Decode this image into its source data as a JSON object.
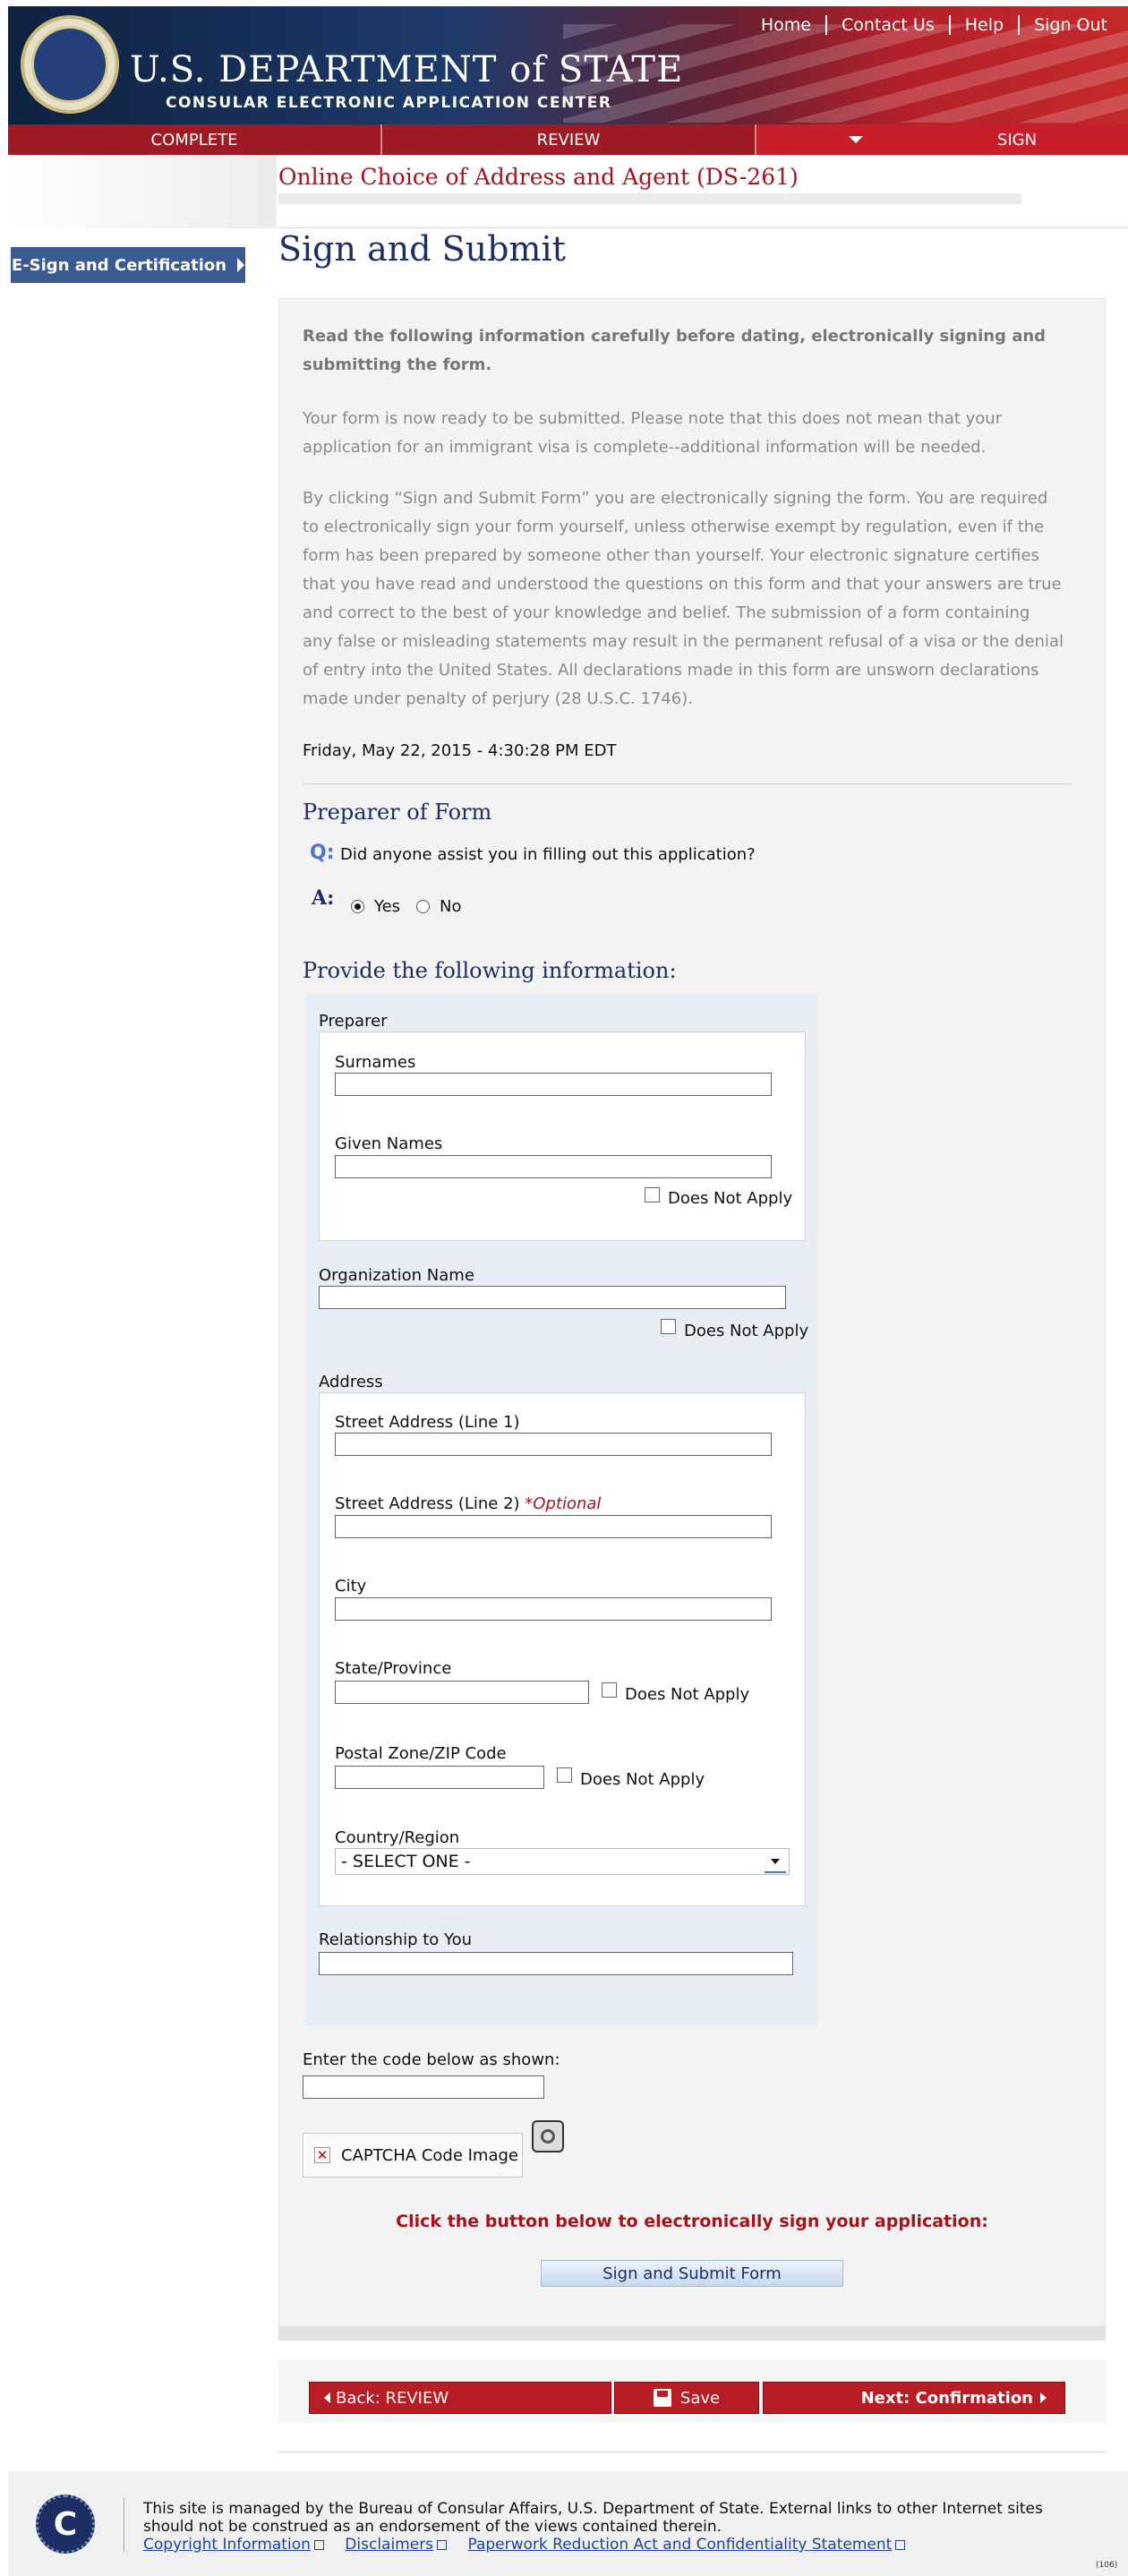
{
  "header": {
    "top_links": [
      "Home",
      "Contact Us",
      "Help",
      "Sign Out"
    ],
    "dept_title": "U.S. DEPARTMENT of STATE",
    "dept_subtitle": "CONSULAR ELECTRONIC APPLICATION CENTER",
    "tabs": [
      "COMPLETE",
      "REVIEW",
      "SIGN"
    ]
  },
  "form_title": "Online Choice of Address and Agent (DS-261)",
  "left_nav": {
    "item": "E-Sign and Certification"
  },
  "page_heading": "Sign and Submit",
  "intro": {
    "bold": "Read the following information carefully before dating, electronically signing and submitting the form.",
    "para1": "Your form is now ready to be submitted. Please note that this does not mean that your application for an immigrant visa is complete--additional information will be needed.",
    "para2": "By clicking “Sign and Submit Form” you are electronically signing the form. You are required to electronically sign your form yourself, unless otherwise exempt by regulation, even if the form has been prepared by someone other than yourself. Your electronic signature certifies that you have read and understood the questions on this form and that your answers are true and correct to the best of your knowledge and belief. The submission of a form containing any false or misleading statements may result in the permanent refusal of a visa or the denial of entry into the United States. All declarations made in this form are unsworn declarations made under penalty of perjury (28 U.S.C. 1746).",
    "timestamp": "Friday, May 22, 2015 - 4:30:28 PM EDT"
  },
  "preparer": {
    "heading": "Preparer of Form",
    "q_label": "Q:",
    "question": "Did anyone assist you in filling out this application?",
    "a_label": "A:",
    "yes": "Yes",
    "no": "No",
    "selected": "Yes"
  },
  "provide_heading": "Provide the following information:",
  "info": {
    "preparer_label": "Preparer",
    "surnames": "Surnames",
    "given_names": "Given Names",
    "does_not_apply": "Does Not Apply",
    "org_name": "Organization Name",
    "address_label": "Address",
    "street1": "Street Address (Line 1)",
    "street2": "Street Address (Line 2)",
    "optional": "*Optional",
    "city": "City",
    "state": "State/Province",
    "postal": "Postal Zone/ZIP Code",
    "country": "Country/Region",
    "country_value": "- SELECT ONE -",
    "relationship": "Relationship to You"
  },
  "captcha": {
    "label": "Enter the code below as shown:",
    "image_alt": "CAPTCHA Code Image"
  },
  "sign": {
    "prompt": "Click the button below to electronically sign your application:",
    "button": "Sign and Submit Form"
  },
  "bottom_nav": {
    "back": "Back: REVIEW",
    "save": "Save",
    "next": "Next: Confirmation"
  },
  "footer": {
    "text": "This site is managed by the Bureau of Consular Affairs, U.S. Department of State. External links to other Internet sites should not be construed as an endorsement of the views contained therein.",
    "links": [
      "Copyright Information",
      "Disclaimers",
      "Paperwork Reduction Act and Confidentiality Statement"
    ],
    "code": "(106)"
  },
  "colors": {
    "navy": "#1c2e63",
    "crimson": "#a3141d",
    "button_red": "#b81d25",
    "panel_bg": "#f3f3f3",
    "info_bg": "#e8eef6"
  }
}
